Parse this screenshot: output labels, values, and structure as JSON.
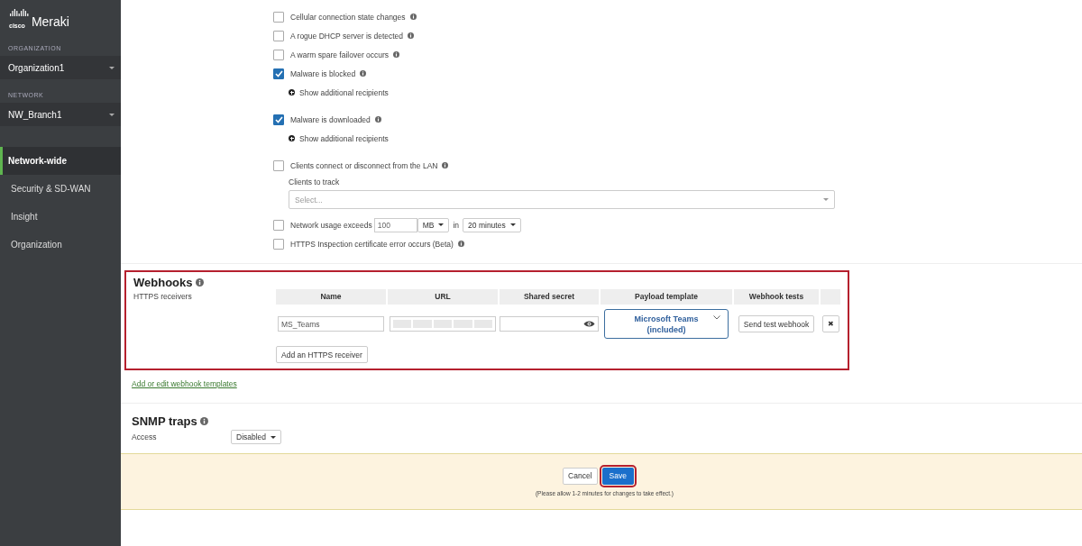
{
  "sidebar": {
    "brand": {
      "vendor": "cisco",
      "product": "Meraki"
    },
    "pickers": [
      {
        "heading": "ORGANIZATION",
        "value": "Organization1"
      },
      {
        "heading": "NETWORK",
        "value": "NW_Branch1"
      }
    ],
    "items": [
      {
        "label": "Network-wide",
        "selected": true
      },
      {
        "label": "Security & SD-WAN",
        "selected": false
      },
      {
        "label": "Insight",
        "selected": false
      },
      {
        "label": "Organization",
        "selected": false
      }
    ]
  },
  "alerts": [
    {
      "kind": "plain",
      "label": "Cellular connection state changes",
      "checked": false
    },
    {
      "kind": "plain",
      "label": "A rogue DHCP server is detected",
      "checked": false
    },
    {
      "kind": "plain",
      "label": "A warm spare failover occurs",
      "checked": false
    },
    {
      "kind": "recipients",
      "label": "Malware is blocked",
      "checked": true,
      "link": "Show additional recipients"
    },
    {
      "kind": "recipients",
      "label": "Malware is downloaded",
      "checked": true,
      "link": "Show additional recipients"
    },
    {
      "kind": "clients",
      "label": "Clients connect or disconnect from the LAN",
      "checked": false,
      "track_label": "Clients to track",
      "placeholder": "Select..."
    },
    {
      "kind": "usage",
      "label": "Network usage exceeds",
      "checked": false,
      "value": "100",
      "unit": "MB",
      "in_label": "in",
      "period": "20 minutes"
    },
    {
      "kind": "plain",
      "label": "HTTPS Inspection certificate error occurs (Beta)",
      "checked": false
    }
  ],
  "webhooks": {
    "title": "Webhooks",
    "highlighted": true,
    "label": "HTTPS receivers",
    "columns": [
      "Name",
      "URL",
      "Shared secret",
      "Payload template",
      "Webhook tests"
    ],
    "rows": [
      {
        "name": "MS_Teams",
        "template": "Microsoft Teams (included)",
        "test_button": "Send test webhook",
        "remove": "✖"
      }
    ],
    "add_button": "Add an HTTPS receiver",
    "templates_link": "Add or edit webhook templates"
  },
  "snmp": {
    "title": "SNMP traps",
    "label": "Access",
    "value": "Disabled"
  },
  "footer": {
    "cancel": "Cancel",
    "save": "Save",
    "save_highlighted": true,
    "note": "(Please allow 1-2 minutes for changes to take effect.)"
  }
}
